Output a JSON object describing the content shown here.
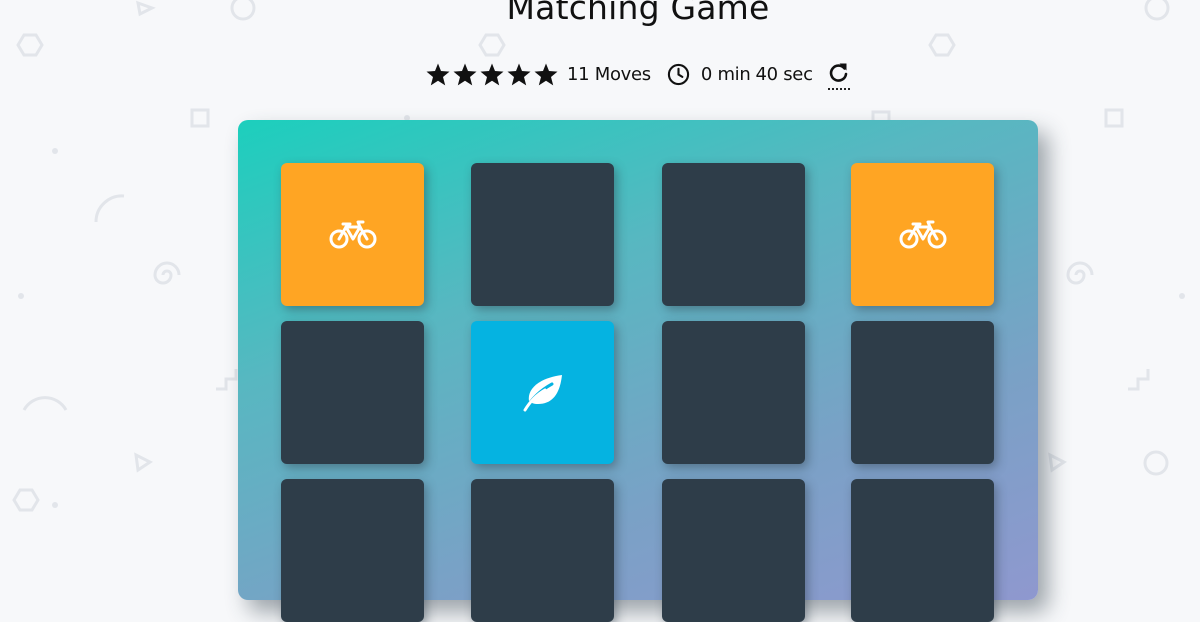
{
  "game": {
    "title": "Matching Game"
  },
  "score_panel": {
    "rating_stars": 5,
    "moves_text": "11 Moves",
    "timer_minutes_text": "0 min",
    "timer_seconds_text": "40 sec",
    "icons": {
      "star": "star-icon",
      "clock": "clock-icon",
      "restart": "restart-icon"
    }
  },
  "deck": {
    "colors": {
      "gradient_start": "#1ccfbd",
      "gradient_end": "#8f98cf",
      "card_closed": "#2e3d49",
      "card_matched": "#ffa523",
      "card_open": "#05b3e1"
    },
    "cards": [
      {
        "state": "match",
        "icon": "bicycle-icon"
      },
      {
        "state": "closed",
        "icon": ""
      },
      {
        "state": "closed",
        "icon": ""
      },
      {
        "state": "match",
        "icon": "bicycle-icon"
      },
      {
        "state": "closed",
        "icon": ""
      },
      {
        "state": "open",
        "icon": "leaf-icon"
      },
      {
        "state": "closed",
        "icon": ""
      },
      {
        "state": "closed",
        "icon": ""
      },
      {
        "state": "closed",
        "icon": ""
      },
      {
        "state": "closed",
        "icon": ""
      },
      {
        "state": "closed",
        "icon": ""
      },
      {
        "state": "closed",
        "icon": ""
      }
    ]
  }
}
